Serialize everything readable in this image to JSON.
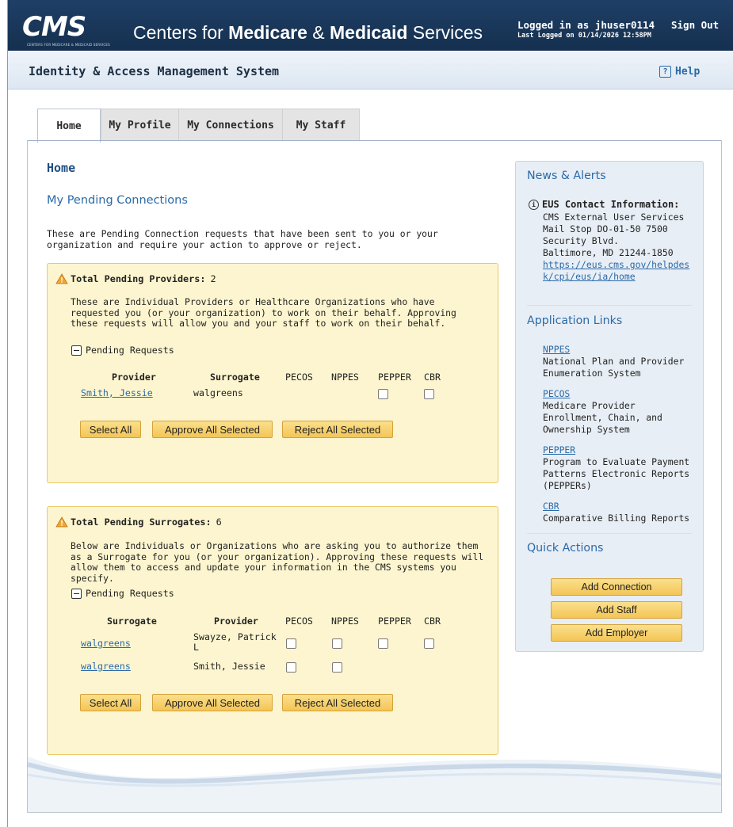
{
  "header": {
    "logo_text": "CMS",
    "logo_subtext": "CENTERS FOR MEDICARE & MEDICAID SERVICES",
    "title_part1": "Centers for ",
    "title_bold1": "Medicare",
    "title_part2": " & ",
    "title_bold2": "Medicaid",
    "title_part3": " Services",
    "login_line": "Logged in as jhuser0114",
    "last_logged": "Last Logged on 01/14/2026 12:58PM",
    "sign_out": "Sign Out"
  },
  "subheader": {
    "system_title": "Identity & Access Management System",
    "help": "Help",
    "help_icon": "?"
  },
  "tabs": [
    {
      "label": "Home",
      "active": true
    },
    {
      "label": "My Profile",
      "active": false
    },
    {
      "label": "My Connections",
      "active": false
    },
    {
      "label": "My Staff",
      "active": false
    }
  ],
  "main": {
    "page_title": "Home",
    "section_title": "My Pending Connections",
    "intro": "These are Pending Connection requests that have been sent to you or your organization and require your action to approve or reject.",
    "providers": {
      "heading": "Total Pending Providers:",
      "count": "2",
      "description": "These are Individual Providers or Healthcare Organizations who have requested you (or your organization) to work on their behalf. Approving these requests will allow you and your staff to work on their behalf.",
      "toggle_label": "Pending Requests",
      "columns": [
        "Provider",
        "Surrogate",
        "PECOS",
        "NPPES",
        "PEPPER",
        "CBR"
      ],
      "rows": [
        {
          "provider": "Smith, Jessie",
          "surrogate": "walgreens"
        }
      ],
      "buttons": {
        "select_all": "Select All",
        "approve": "Approve All Selected",
        "reject": "Reject All Selected"
      }
    },
    "surrogates": {
      "heading": "Total Pending Surrogates:",
      "count": "6",
      "description": "Below are Individuals or Organizations who are asking you to authorize them as a Surrogate for you (or your organization). Approving these requests will allow them to access and update your information in the CMS systems you specify.",
      "toggle_label": "Pending Requests",
      "columns": [
        "Surrogate",
        "Provider",
        "PECOS",
        "NPPES",
        "PEPPER",
        "CBR"
      ],
      "rows": [
        {
          "surrogate": "walgreens",
          "provider_line1": "Swayze, Patrick",
          "provider_line2": "L"
        },
        {
          "surrogate": "walgreens",
          "provider_line1": "Smith, Jessie",
          "provider_line2": ""
        }
      ],
      "buttons": {
        "select_all": "Select All",
        "approve": "Approve All Selected",
        "reject": "Reject All Selected"
      }
    }
  },
  "sidebar": {
    "news_title": "News & Alerts",
    "info_icon": "i",
    "eus_heading": "EUS Contact Information:",
    "eus_lines": [
      "CMS External User Services",
      "Mail Stop DO-01-50 7500",
      "Security Blvd.",
      "Baltimore, MD 21244-1850"
    ],
    "eus_link": "https://eus.cms.gov/helpdesk/cpi/eus/ia/home",
    "links_title": "Application Links",
    "app_links": [
      {
        "label": "NPPES",
        "desc": "National Plan and Provider Enumeration System"
      },
      {
        "label": "PECOS",
        "desc": "Medicare Provider Enrollment, Chain, and Ownership System"
      },
      {
        "label": "PEPPER",
        "desc": "Program to Evaluate Payment Patterns Electronic Reports (PEPPERs)"
      },
      {
        "label": "CBR",
        "desc": "Comparative Billing Reports"
      }
    ],
    "quick_title": "Quick Actions",
    "quick_actions": [
      "Add Connection",
      "Add Staff",
      "Add Employer"
    ]
  },
  "colors": {
    "header_bg": "#15304f",
    "link": "#2a6aa8",
    "panel_bg": "#fdf5cf",
    "button": "#f3c556"
  }
}
